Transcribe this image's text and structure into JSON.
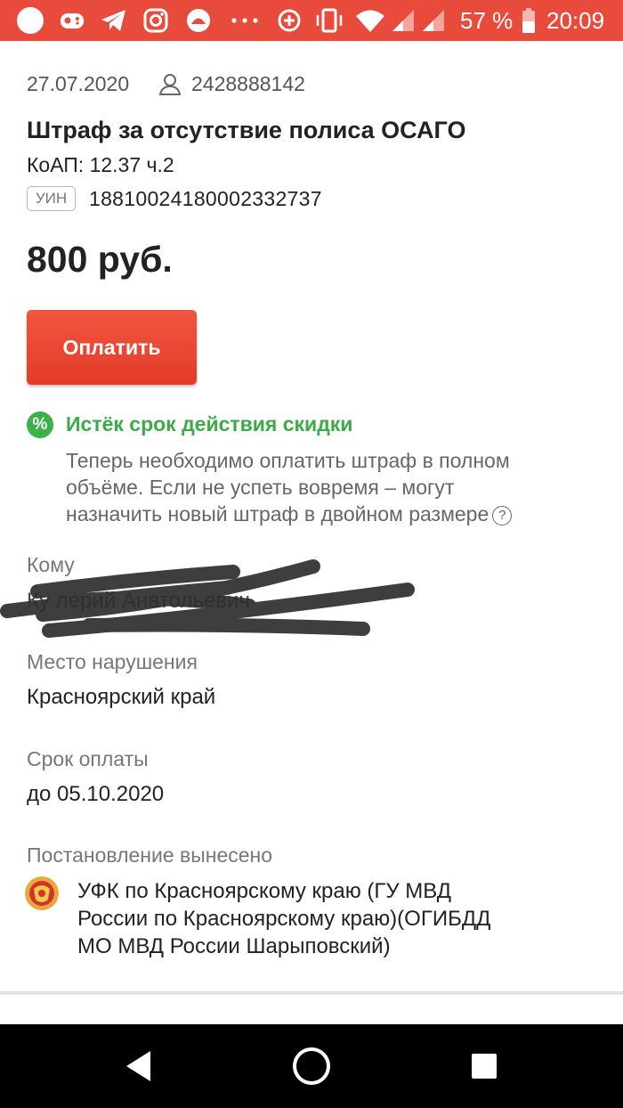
{
  "status_bar": {
    "battery_percent": "57 %",
    "time": "20:09",
    "colors": {
      "background": "#e84a3c",
      "foreground": "#ffffff"
    },
    "icons": [
      "notification-dot-icon",
      "game-icon",
      "telegram-icon",
      "instagram-icon",
      "app-icon",
      "more-dots-icon",
      "crosshair-icon",
      "vibrate-icon",
      "wifi-icon",
      "signal-icon",
      "signal-icon",
      "battery-icon"
    ]
  },
  "fine": {
    "date": "27.07.2020",
    "user_id": "2428888142",
    "title": "Штраф за отсутствие полиса ОСАГО",
    "article": "КоАП: 12.37 ч.2",
    "uin_label": "УИН",
    "uin": "18810024180002332737",
    "amount": "800 руб.",
    "pay_button": "Оплатить"
  },
  "discount": {
    "icon": "%",
    "title": "Истёк срок действия скидки",
    "text_lines": [
      "Теперь необходимо оплатить штраф в полном",
      "объёме. Если не успеть вовремя – могут",
      "назначить новый штраф в двойном размере"
    ],
    "colors": {
      "accent": "#3daa48"
    }
  },
  "details": {
    "recipient_label": "Кому",
    "recipient_visible_text": "Ку          лерий Анатольевич",
    "place_label": "Место нарушения",
    "place": "Красноярский край",
    "deadline_label": "Срок оплаты",
    "deadline": "до 05.10.2020",
    "issuer_label": "Постановление вынесено",
    "issuer_lines": [
      "УФК по Красноярскому краю (ГУ МВД",
      "России по Красноярскому краю)(ОГИБДД",
      "МО МВД России Шарыповский)"
    ]
  },
  "colors": {
    "pay_button": "#e84a3c",
    "text_primary": "#222222",
    "text_secondary": "#777777"
  }
}
